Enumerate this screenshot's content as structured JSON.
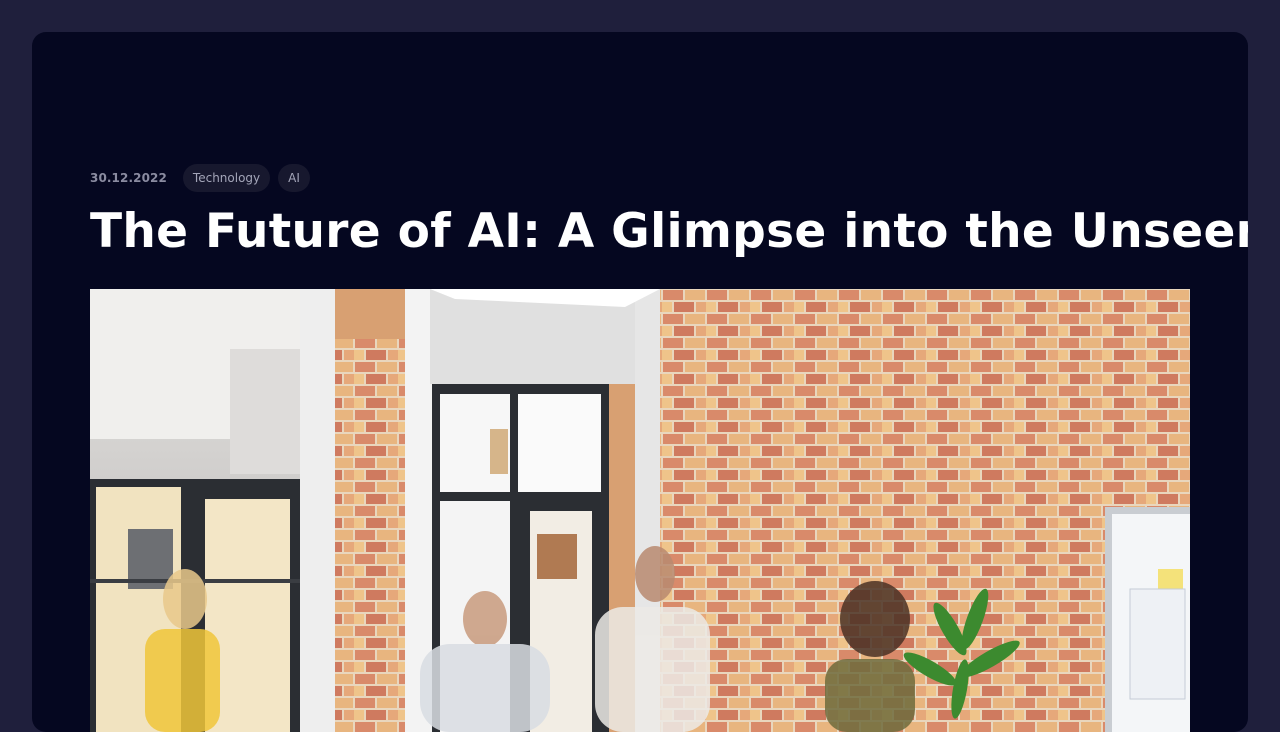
{
  "article": {
    "date": "30.12.2022",
    "tags": [
      "Technology",
      "AI"
    ],
    "title": "The Future of AI: A Glimpse into the Unseen"
  },
  "hero_image": {
    "subject": "office-scene-photo"
  },
  "colors": {
    "page_bg": "#1f1f3c",
    "card_bg": "#050720",
    "tag_bg": "#17182e",
    "title": "#ffffff",
    "meta_text": "#8a8ba0"
  }
}
